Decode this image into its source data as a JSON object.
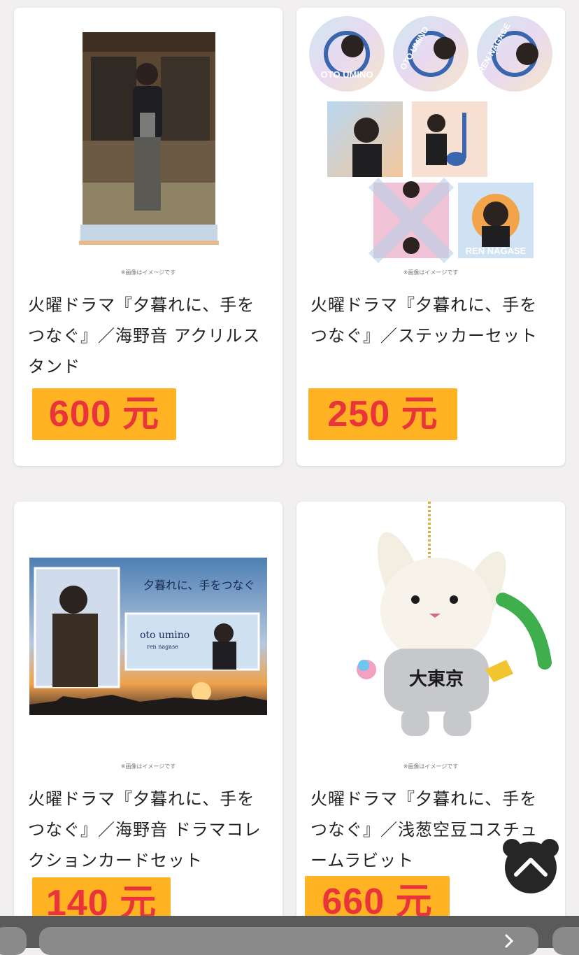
{
  "products": [
    {
      "title": "火曜ドラマ『夕暮れに、手をつなぐ』／海野音 アクリルスタンド",
      "price": "600 元",
      "image_note": "※画像はイメージです",
      "image_alt": "acrylic stand of actor in black jacket in front of old house"
    },
    {
      "title": "火曜ドラマ『夕暮れに、手をつなぐ』／ステッカーセット",
      "price": "250 元",
      "image_note": "※画像はイメージです",
      "image_alt": "sticker set",
      "sticker_texts": [
        "OTO UMINO",
        "OTO UMINO",
        "REN NAGASE",
        "REN NAGASE"
      ]
    },
    {
      "title": "火曜ドラマ『夕暮れに、手をつなぐ』／海野音 ドラマコレクションカードセット",
      "price": "140 元",
      "image_note": "※画像はイメージです",
      "image_alt": "drama collection card set",
      "card_texts": [
        "夕暮れに、手をつなぐ",
        "oto umino",
        "ren nagase"
      ]
    },
    {
      "title": "火曜ドラマ『夕暮れに、手をつなぐ』／浅葱空豆コスチュームラビット",
      "price": "660 元",
      "image_note": "※画像はイメージです",
      "image_alt": "costume rabbit plush keychain",
      "shirt_text": "大東京"
    }
  ],
  "colors": {
    "price_bg": "#ffb323",
    "price_text": "#e8343a",
    "page_bg": "#f1efef"
  },
  "icons": {
    "scroll_top": "chevron-up-icon",
    "next": "chevron-right-icon"
  }
}
